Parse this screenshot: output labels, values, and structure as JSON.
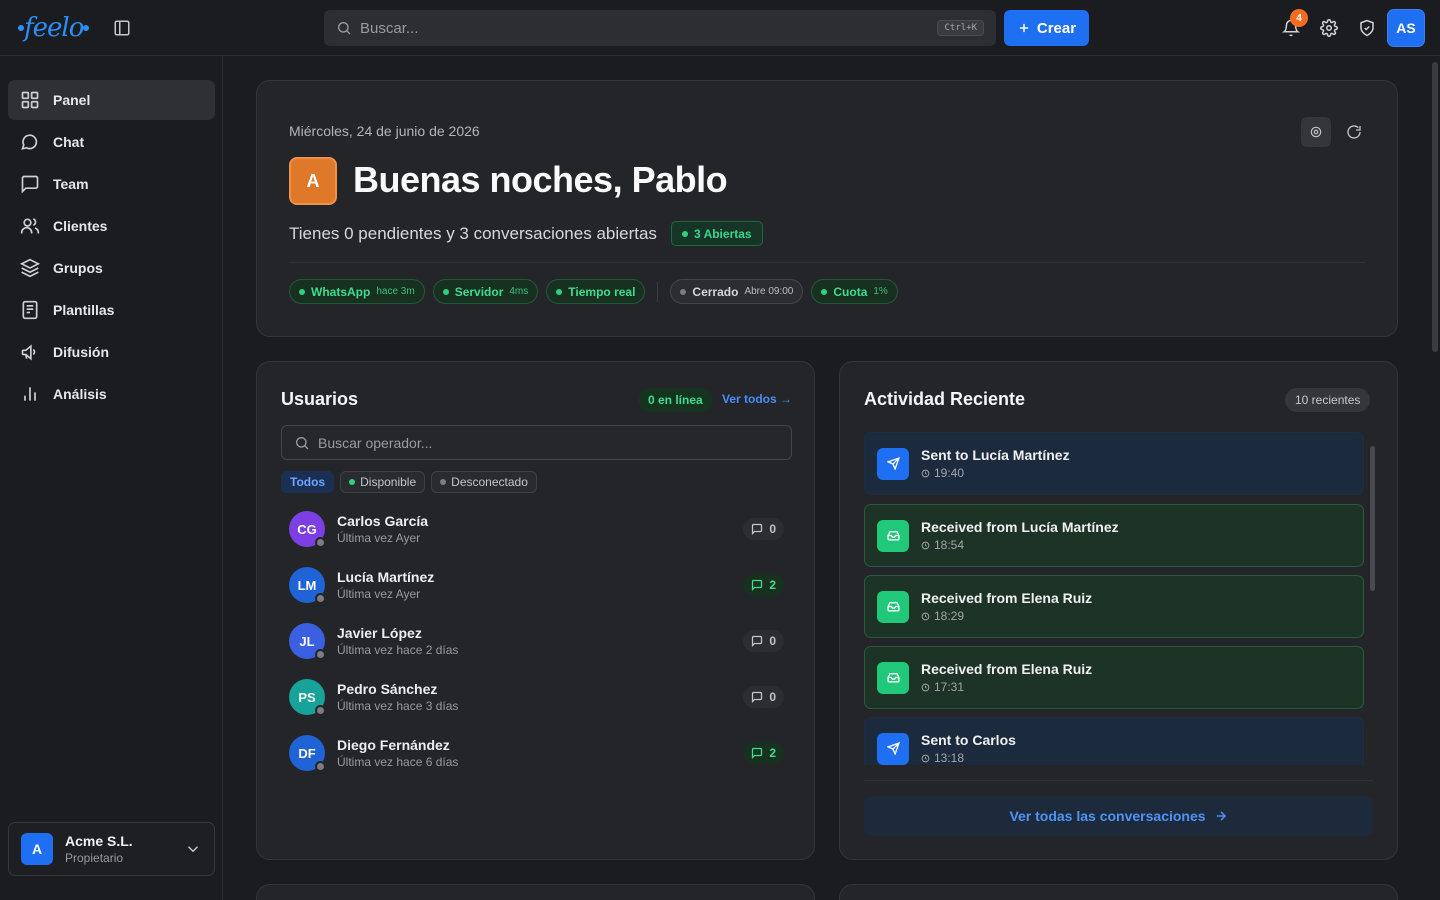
{
  "topbar": {
    "logo": "feelo",
    "search_placeholder": "Buscar...",
    "search_shortcut": "Ctrl+K",
    "create_label": "Crear",
    "notifications_count": "4",
    "user_initials": "AS"
  },
  "sidebar": {
    "items": [
      {
        "label": "Panel",
        "icon": "grid-icon",
        "active": true
      },
      {
        "label": "Chat",
        "icon": "chat-bubble-icon"
      },
      {
        "label": "Team",
        "icon": "message-square-icon"
      },
      {
        "label": "Clientes",
        "icon": "users-icon"
      },
      {
        "label": "Grupos",
        "icon": "layers-icon"
      },
      {
        "label": "Plantillas",
        "icon": "document-icon"
      },
      {
        "label": "Difusión",
        "icon": "megaphone-icon"
      },
      {
        "label": "Análisis",
        "icon": "bar-chart-icon"
      }
    ],
    "org": {
      "initial": "A",
      "name": "Acme S.L.",
      "role": "Propietario"
    }
  },
  "hero": {
    "date": "Miércoles, 24 de junio de 2026",
    "avatar_initial": "A",
    "greeting": "Buenas noches, Pablo",
    "summary": "Tienes 0 pendientes y 3 conversaciones abiertas",
    "open_badge": "3 Abiertas",
    "status_chips": [
      {
        "label": "WhatsApp",
        "detail": "hace 3m",
        "state": "ok"
      },
      {
        "label": "Servidor",
        "detail": "4ms",
        "state": "ok"
      },
      {
        "label": "Tiempo real",
        "detail": "",
        "state": "ok"
      },
      {
        "label": "Cerrado",
        "detail": "Abre 09:00",
        "state": "off"
      },
      {
        "label": "Cuota",
        "detail": "1%",
        "state": "ok"
      }
    ]
  },
  "users": {
    "title": "Usuarios",
    "online": "0 en línea",
    "view_all": "Ver todos →",
    "search_placeholder": "Buscar operador...",
    "filters": [
      "Todos",
      "Disponible",
      "Desconectado"
    ],
    "list": [
      {
        "initials": "CG",
        "name": "Carlos García",
        "last_seen": "Última vez Ayer",
        "count": "0",
        "color": "#7b3fe4"
      },
      {
        "initials": "LM",
        "name": "Lucía Martínez",
        "last_seen": "Última vez Ayer",
        "count": "2",
        "color": "#1f63d6"
      },
      {
        "initials": "JL",
        "name": "Javier López",
        "last_seen": "Última vez hace 2 días",
        "count": "0",
        "color": "#3a5fe0"
      },
      {
        "initials": "PS",
        "name": "Pedro Sánchez",
        "last_seen": "Última vez hace 3 días",
        "count": "0",
        "color": "#18a39a"
      },
      {
        "initials": "DF",
        "name": "Diego Fernández",
        "last_seen": "Última vez hace 6 días",
        "count": "2",
        "color": "#1f63d6"
      }
    ]
  },
  "activity": {
    "title": "Actividad Reciente",
    "recent": "10 recientes",
    "items": [
      {
        "type": "sent",
        "title": "Sent to Lucía Martínez",
        "time": "19:40"
      },
      {
        "type": "recv",
        "title": "Received from Lucía Martínez",
        "time": "18:54"
      },
      {
        "type": "recv",
        "title": "Received from Elena Ruiz",
        "time": "18:29"
      },
      {
        "type": "recv",
        "title": "Received from Elena Ruiz",
        "time": "17:31"
      },
      {
        "type": "sent",
        "title": "Sent to Carlos",
        "time": "13:18"
      }
    ],
    "footer": "Ver todas las conversaciones"
  }
}
